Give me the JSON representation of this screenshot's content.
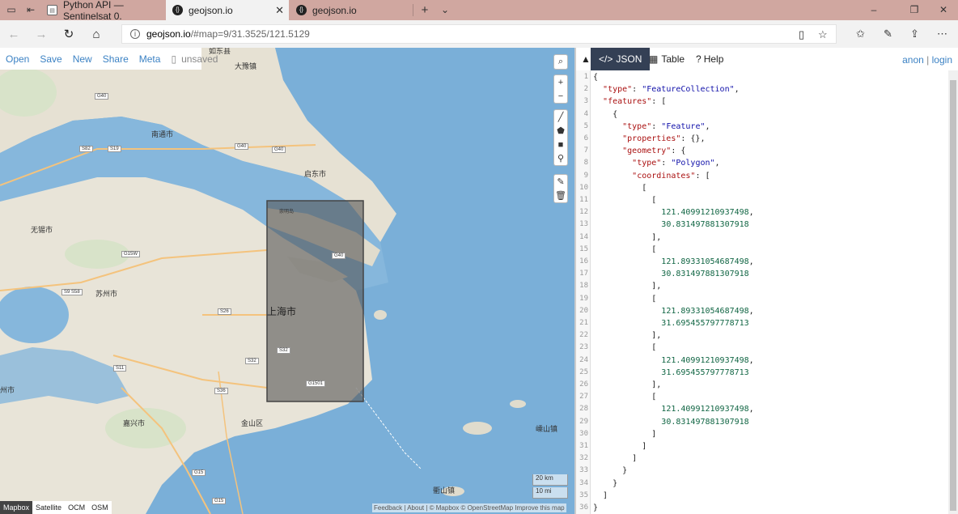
{
  "browser": {
    "tabs": [
      {
        "title": "Python API — Sentinelsat 0.",
        "favicon": "doc-icon"
      },
      {
        "title": "geojson.io",
        "favicon": "geojson-icon"
      },
      {
        "title": "geojson.io",
        "favicon": "geojson-icon"
      }
    ],
    "url_domain": "geojson.io",
    "url_rest": "/#map=9/31.3525/121.5129"
  },
  "toolbar": {
    "open": "Open",
    "save": "Save",
    "new": "New",
    "share": "Share",
    "meta": "Meta",
    "unsaved": "unsaved"
  },
  "map": {
    "labels": {
      "rudong": "如东县",
      "dayu": "大豫镇",
      "nantong": "南通市",
      "qidong": "启东市",
      "wuxi": "无锡市",
      "suzhou": "苏州市",
      "shanghai": "上海市",
      "jiaxing": "嘉兴市",
      "jinshan": "金山区",
      "shengsi": "嵊山镇",
      "qushan": "衢山镇",
      "chongming": "崇明岛",
      "huzhou": "州市"
    },
    "shields": [
      "G40",
      "S82",
      "S19",
      "G40",
      "G40",
      "G15W",
      "S9 S58",
      "S26",
      "S32",
      "S11",
      "G1501",
      "S36",
      "G40",
      "G15",
      "G15",
      "S32"
    ],
    "layers": [
      "Mapbox",
      "Satellite",
      "OCM",
      "OSM"
    ],
    "scale_km": "20 km",
    "scale_mi": "10 mi",
    "attribution": "Feedback | About | © Mapbox © OpenStreetMap Improve this map"
  },
  "panel": {
    "tabs": {
      "json": "JSON",
      "table": "Table",
      "help": "Help"
    },
    "anon": "anon",
    "sep": "|",
    "login": "login"
  },
  "editor": {
    "lines": [
      "{",
      "  \"type\": \"FeatureCollection\",",
      "  \"features\": [",
      "    {",
      "      \"type\": \"Feature\",",
      "      \"properties\": {},",
      "      \"geometry\": {",
      "        \"type\": \"Polygon\",",
      "        \"coordinates\": [",
      "          [",
      "            [",
      "              121.40991210937498,",
      "              30.831497881307918",
      "            ],",
      "            [",
      "              121.89331054687498,",
      "              30.831497881307918",
      "            ],",
      "            [",
      "              121.89331054687498,",
      "              31.695455797778713",
      "            ],",
      "            [",
      "              121.40991210937498,",
      "              31.695455797778713",
      "            ],",
      "            [",
      "              121.40991210937498,",
      "              30.831497881307918",
      "            ]",
      "          ]",
      "        ]",
      "      }",
      "    }",
      "  ]",
      "}"
    ]
  },
  "colors": {
    "tabbar": "#d0a7a0",
    "link": "#3c82c4",
    "active_tab": "#344055",
    "water": "#7aafd8",
    "land": "#e8e4d8"
  }
}
